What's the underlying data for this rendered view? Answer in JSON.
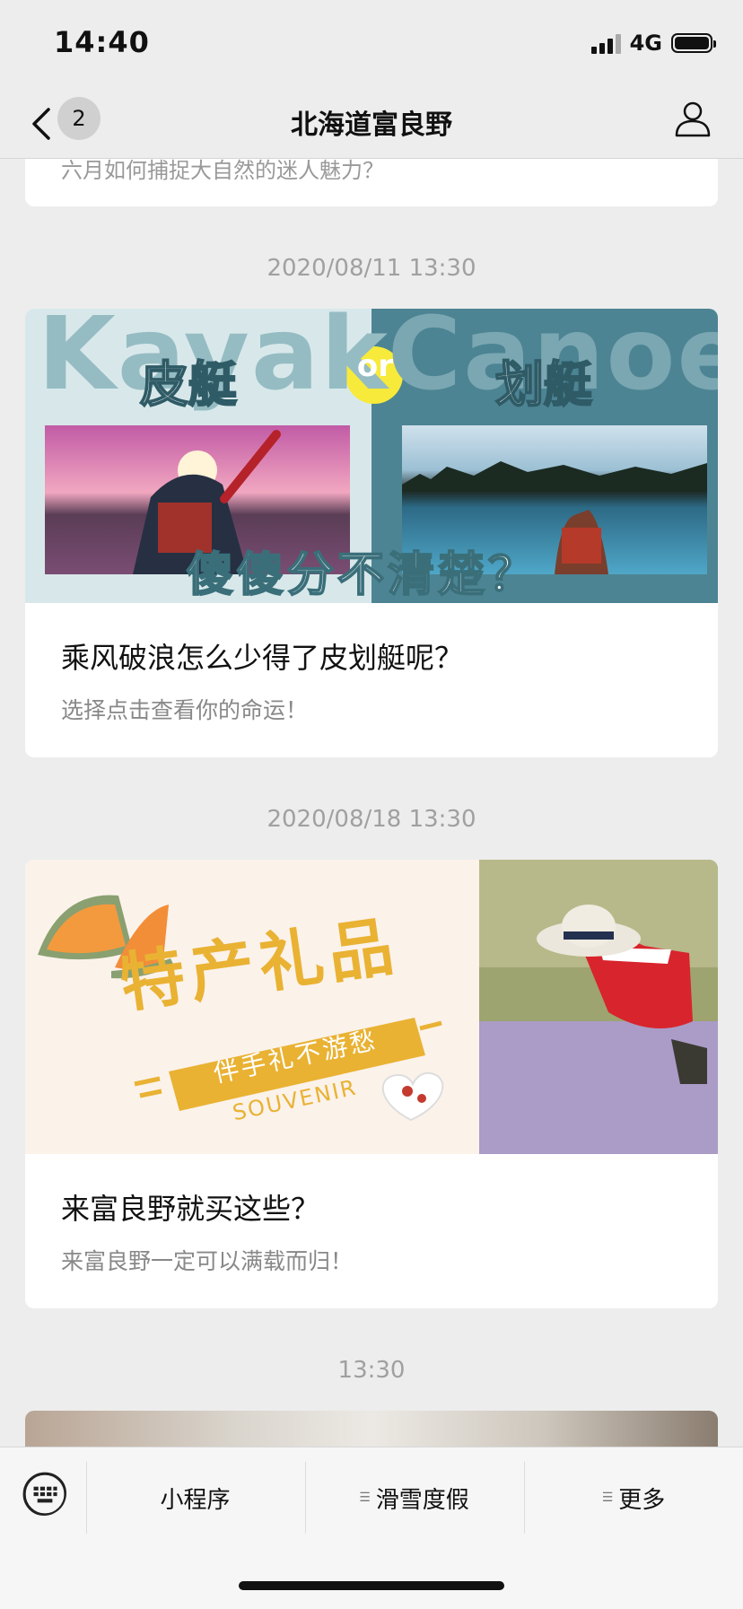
{
  "status": {
    "time": "14:40",
    "network": "4G"
  },
  "nav": {
    "badge": "2",
    "title": "北海道富良野"
  },
  "feed": {
    "prev_snippet": "六月如何捕捉大自然的迷人魅力？",
    "items": [
      {
        "timestamp": "2020/08/11 13:30",
        "title": "乘风破浪怎么少得了皮划艇呢？",
        "subtitle": "选择点击查看你的命运！",
        "image": {
          "left_word": "Kayak",
          "right_word": "Canoe",
          "left_label": "皮艇",
          "middle_badge": "or",
          "right_label": "划艇",
          "caption": "傻傻分不清楚？"
        }
      },
      {
        "timestamp": "2020/08/18 13:30",
        "title": "来富良野就买这些？",
        "subtitle": "来富良野一定可以满载而归！",
        "image": {
          "headline": "特产礼品",
          "ribbon": "伴手礼不游愁",
          "english": "SOUVENIR"
        }
      },
      {
        "timestamp": "13:30"
      }
    ]
  },
  "bottom_menu": {
    "items": [
      {
        "label": "小程序"
      },
      {
        "label": "滑雪度假"
      },
      {
        "label": "更多"
      }
    ]
  },
  "colors": {
    "background": "#ededed",
    "card": "#ffffff",
    "timestamp": "#a0a0a0",
    "canoe_teal": "#4d8493",
    "souvenir_gold": "#e9b233"
  },
  "icons": [
    "back-chevron-icon",
    "user-icon",
    "keyboard-icon",
    "menu-lines-icon"
  ]
}
